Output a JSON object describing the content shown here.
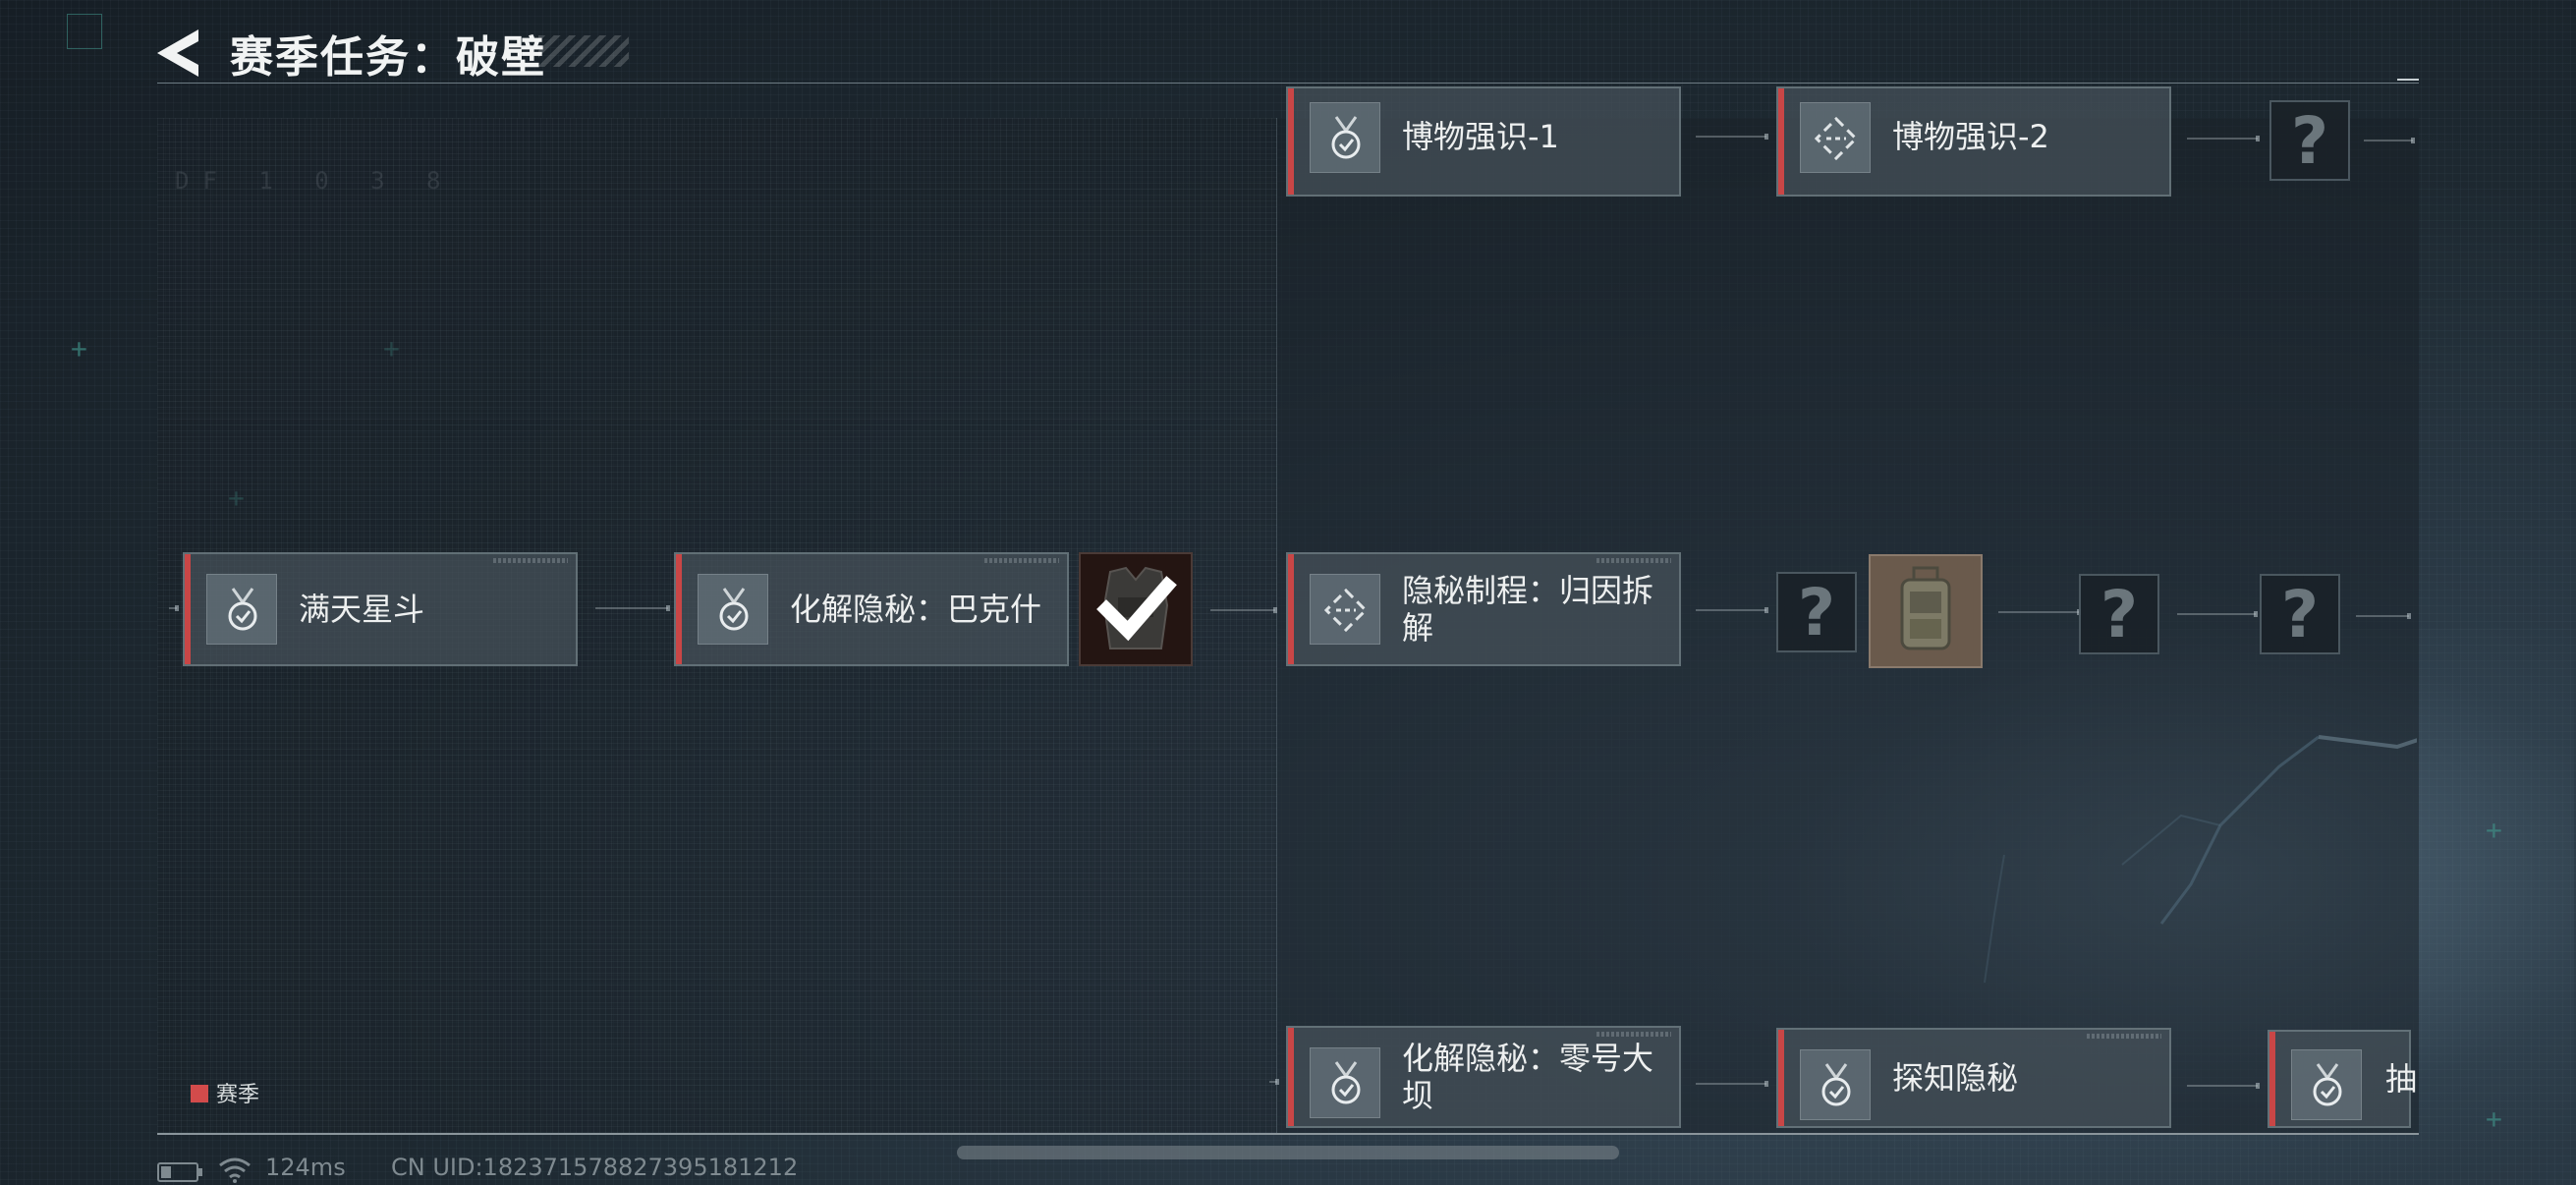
{
  "header": {
    "title": "赛季任务：破壁",
    "back_icon": "back-arrow-icon"
  },
  "tasks": {
    "mantian": "满天星斗",
    "huajie_bakeshi": "化解隐秘：巴克什",
    "bowu_1": "博物强识-1",
    "bowu_2": "博物强识-2",
    "yinmi_zhicheng": "隐秘制程：归因拆解",
    "huajie_linghao": "化解隐秘：零号大坝",
    "tanzhi": "探知隐秘",
    "chou_partial": "抽"
  },
  "unknown_symbol": "?",
  "legend": {
    "label": "赛季",
    "color": "#d24b4b"
  },
  "status": {
    "ping": "124ms",
    "uid": "CN UID:182371578827395181212"
  },
  "accent_color": "#c94646"
}
